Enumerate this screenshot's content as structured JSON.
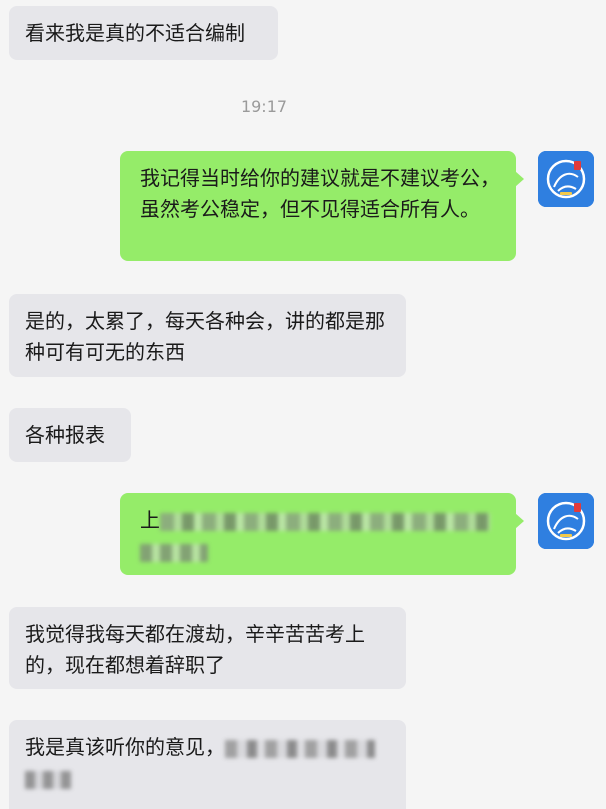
{
  "messages": {
    "m1": "看来我是真的不适合编制",
    "time": "19:17",
    "m2": "我记得当时给你的建议就是不建议考公，虽然考公稳定，但不见得适合所有人。",
    "m3": "是的，太累了，每天各种会，讲的都是那种可有可无的东西",
    "m4": "各种报表",
    "m5_visible": "上",
    "m6": "我觉得我每天都在渡劫，辛辛苦苦考上的，现在都想着辞职了",
    "m7_visible": "我是真该听你的意见，"
  },
  "colors": {
    "outgoing_bubble": "#95ec69",
    "incoming_bubble": "#e6e6ea",
    "background": "#f5f5f5",
    "avatar_bg": "#2f7fe0"
  },
  "icons": {
    "avatar": "blue-square-avatar-icon"
  }
}
